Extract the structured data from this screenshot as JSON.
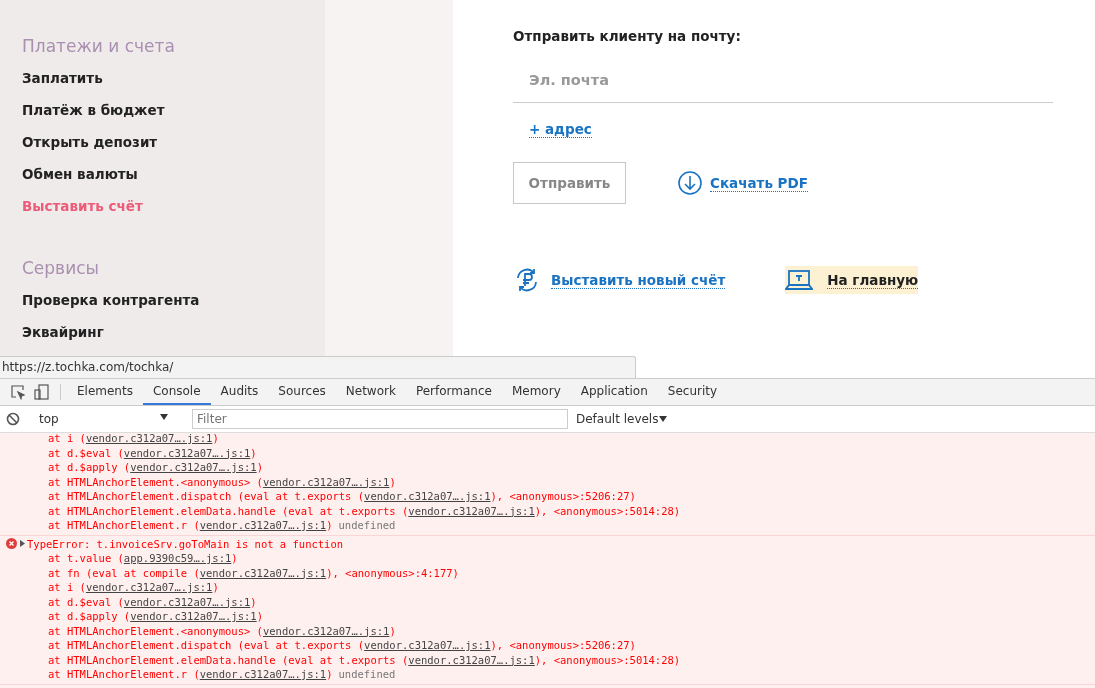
{
  "sidebar": {
    "sections": [
      {
        "title": "Платежи и счета",
        "items": [
          {
            "label": "Заплатить",
            "selected": false
          },
          {
            "label": "Платёж в бюджет",
            "selected": false
          },
          {
            "label": "Открыть депозит",
            "selected": false
          },
          {
            "label": "Обмен валюты",
            "selected": false
          },
          {
            "label": "Выставить счёт",
            "selected": true
          }
        ]
      },
      {
        "title": "Сервисы",
        "items": [
          {
            "label": "Проверка контрагента",
            "selected": false
          },
          {
            "label": "Эквайринг",
            "selected": false
          }
        ]
      }
    ]
  },
  "send": {
    "heading": "Отправить клиенту на почту:",
    "email": {
      "placeholder": "Эл. почта"
    },
    "add_address": "+ адрес",
    "send_button": {
      "label": "Отправить",
      "disabled": true
    },
    "download": "Скачать PDF"
  },
  "actions": [
    {
      "kind": "new-invoice",
      "label": "Выставить новый счёт",
      "highlighted": false
    },
    {
      "kind": "home",
      "label": "На главную",
      "highlighted": true
    }
  ],
  "status_url": "https://z.tochka.com/tochka/",
  "devtools": {
    "tabs": [
      {
        "label": "Elements",
        "selected": false
      },
      {
        "label": "Console",
        "selected": true
      },
      {
        "label": "Audits",
        "selected": false
      },
      {
        "label": "Sources",
        "selected": false
      },
      {
        "label": "Network",
        "selected": false
      },
      {
        "label": "Performance",
        "selected": false
      },
      {
        "label": "Memory",
        "selected": false
      },
      {
        "label": "Application",
        "selected": false
      },
      {
        "label": "Security",
        "selected": false
      }
    ],
    "context": "top",
    "filter": {
      "placeholder": "Filter"
    },
    "levels": "Default levels",
    "messages": [
      {
        "lines": [
          [
            {
              "kind": "text",
              "text": "at i ("
            },
            {
              "kind": "link",
              "text": "vendor.c312a07….js:1"
            },
            {
              "kind": "text",
              "text": ")"
            }
          ],
          [
            {
              "kind": "text",
              "text": "at d.$eval ("
            },
            {
              "kind": "link",
              "text": "vendor.c312a07….js:1"
            },
            {
              "kind": "text",
              "text": ")"
            }
          ],
          [
            {
              "kind": "text",
              "text": "at d.$apply ("
            },
            {
              "kind": "link",
              "text": "vendor.c312a07….js:1"
            },
            {
              "kind": "text",
              "text": ")"
            }
          ],
          [
            {
              "kind": "text",
              "text": "at HTMLAnchorElement.<anonymous> ("
            },
            {
              "kind": "link",
              "text": "vendor.c312a07….js:1"
            },
            {
              "kind": "text",
              "text": ")"
            }
          ],
          [
            {
              "kind": "text",
              "text": "at HTMLAnchorElement.dispatch (eval at t.exports ("
            },
            {
              "kind": "link",
              "text": "vendor.c312a07….js:1"
            },
            {
              "kind": "text",
              "text": "), <anonymous>:5206:27)"
            }
          ],
          [
            {
              "kind": "text",
              "text": "at HTMLAnchorElement.elemData.handle (eval at t.exports ("
            },
            {
              "kind": "link",
              "text": "vendor.c312a07….js:1"
            },
            {
              "kind": "text",
              "text": "), <anonymous>:5014:28)"
            }
          ],
          [
            {
              "kind": "text",
              "text": "at HTMLAnchorElement.r ("
            },
            {
              "kind": "link",
              "text": "vendor.c312a07….js:1"
            },
            {
              "kind": "text",
              "text": ")"
            },
            {
              "kind": "muted",
              "text": "undefined"
            }
          ]
        ]
      },
      {
        "header": "TypeError: t.invoiceSrv.goToMain is not a function",
        "lines": [
          [
            {
              "kind": "text",
              "text": "at t.value ("
            },
            {
              "kind": "link",
              "text": "app.9390c59….js:1"
            },
            {
              "kind": "text",
              "text": ")"
            }
          ],
          [
            {
              "kind": "text",
              "text": "at fn (eval at compile ("
            },
            {
              "kind": "link",
              "text": "vendor.c312a07….js:1"
            },
            {
              "kind": "text",
              "text": "), <anonymous>:4:177)"
            }
          ],
          [
            {
              "kind": "text",
              "text": "at i ("
            },
            {
              "kind": "link",
              "text": "vendor.c312a07….js:1"
            },
            {
              "kind": "text",
              "text": ")"
            }
          ],
          [
            {
              "kind": "text",
              "text": "at d.$eval ("
            },
            {
              "kind": "link",
              "text": "vendor.c312a07….js:1"
            },
            {
              "kind": "text",
              "text": ")"
            }
          ],
          [
            {
              "kind": "text",
              "text": "at d.$apply ("
            },
            {
              "kind": "link",
              "text": "vendor.c312a07….js:1"
            },
            {
              "kind": "text",
              "text": ")"
            }
          ],
          [
            {
              "kind": "text",
              "text": "at HTMLAnchorElement.<anonymous> ("
            },
            {
              "kind": "link",
              "text": "vendor.c312a07….js:1"
            },
            {
              "kind": "text",
              "text": ")"
            }
          ],
          [
            {
              "kind": "text",
              "text": "at HTMLAnchorElement.dispatch (eval at t.exports ("
            },
            {
              "kind": "link",
              "text": "vendor.c312a07….js:1"
            },
            {
              "kind": "text",
              "text": "), <anonymous>:5206:27)"
            }
          ],
          [
            {
              "kind": "text",
              "text": "at HTMLAnchorElement.elemData.handle (eval at t.exports ("
            },
            {
              "kind": "link",
              "text": "vendor.c312a07….js:1"
            },
            {
              "kind": "text",
              "text": "), <anonymous>:5014:28)"
            }
          ],
          [
            {
              "kind": "text",
              "text": "at HTMLAnchorElement.r ("
            },
            {
              "kind": "link",
              "text": "vendor.c312a07….js:1"
            },
            {
              "kind": "text",
              "text": ")"
            },
            {
              "kind": "muted",
              "text": "undefined"
            }
          ]
        ]
      }
    ]
  }
}
